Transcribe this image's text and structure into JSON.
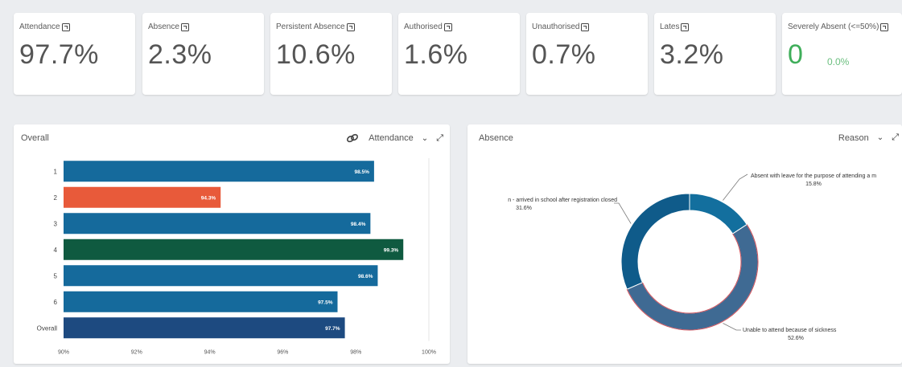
{
  "kpis": [
    {
      "label": "Attendance",
      "value": "97.7%"
    },
    {
      "label": "Absence",
      "value": "2.3%"
    },
    {
      "label": "Persistent Absence",
      "value": "10.6%"
    },
    {
      "label": "Authorised",
      "value": "1.6%"
    },
    {
      "label": "Unauthorised",
      "value": "0.7%"
    },
    {
      "label": "Lates",
      "value": "3.2%"
    },
    {
      "label": "Severely Absent (<=50%)",
      "value": "0",
      "sub": "0.0%"
    }
  ],
  "left_panel": {
    "title": "Overall",
    "selector": "Attendance",
    "icons": [
      "link-icon",
      "chevron-down-icon",
      "expand-icon"
    ]
  },
  "right_panel": {
    "title": "Absence",
    "selector": "Reason",
    "icons": [
      "chevron-down-icon",
      "expand-icon"
    ]
  },
  "colors": {
    "bar_blue": "#156a9c",
    "bar_orange": "#e85a3a",
    "bar_green": "#0f5a40",
    "bar_navy": "#1d4a80",
    "donut_dark": "#0f5b8a",
    "donut_mid": "#136f9e",
    "donut_grey": "#3f6a93",
    "donut_outline": "#d0515a",
    "green": "#3fae5a"
  },
  "chart_data": [
    {
      "type": "bar",
      "orientation": "horizontal",
      "categories": [
        "1",
        "2",
        "3",
        "4",
        "5",
        "6",
        "Overall"
      ],
      "values": [
        98.5,
        94.3,
        98.4,
        99.3,
        98.6,
        97.5,
        97.7
      ],
      "labels": [
        "98.5%",
        "94.3%",
        "98.4%",
        "99.3%",
        "98.6%",
        "97.5%",
        "97.7%"
      ],
      "bar_colors": [
        "#156a9c",
        "#e85a3a",
        "#156a9c",
        "#0f5a40",
        "#156a9c",
        "#156a9c",
        "#1d4a80"
      ],
      "xlim": [
        90,
        100
      ],
      "xticks": [
        "90%",
        "92%",
        "94%",
        "96%",
        "98%",
        "100%"
      ]
    },
    {
      "type": "pie",
      "donut": true,
      "slices": [
        {
          "label": "Absent with leave for the purpose of attending a m",
          "pct_label": "15.8%",
          "value": 15.8,
          "color": "#136f9e"
        },
        {
          "label": "Unable to attend because of sickness",
          "pct_label": "52.6%",
          "value": 52.6,
          "color": "#3f6a93"
        },
        {
          "label": "n - arrived in school after registration closed",
          "pct_label": "31.6%",
          "value": 31.6,
          "color": "#0f5b8a"
        }
      ]
    }
  ]
}
